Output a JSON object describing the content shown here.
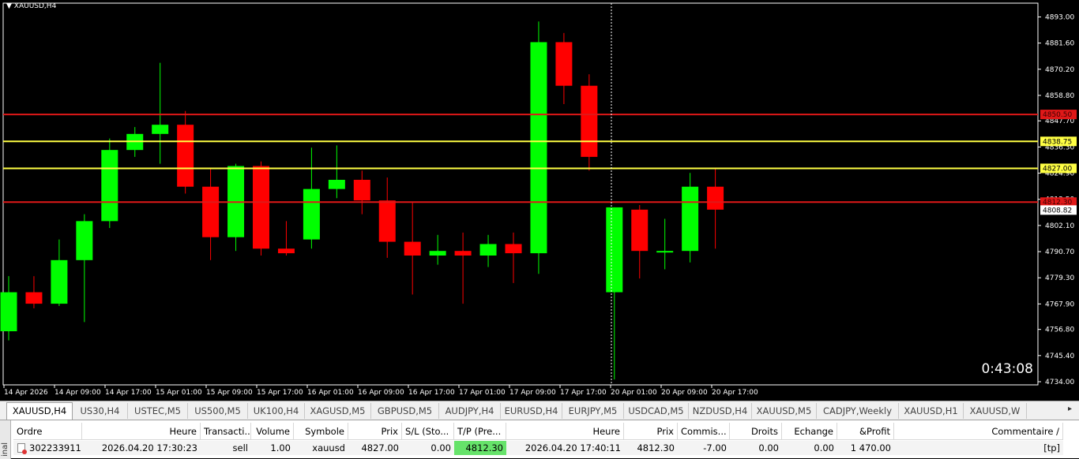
{
  "window": {
    "title": "XAUUSD,H4"
  },
  "countdown": "0:43:08",
  "colors": {
    "bull": "#00ff00",
    "bear": "#ff0000",
    "resistance_line": "#e01818",
    "yellow_line": "#ffff44",
    "axis": "#ffffff"
  },
  "chart_data": {
    "type": "candlestick",
    "symbol": "XAUUSD",
    "timeframe": "H4",
    "ylim": [
      4734,
      4899
    ],
    "y_ticks": [
      "4893.00",
      "4881.60",
      "4870.20",
      "4858.80",
      "4847.70",
      "4836.30",
      "4824.90",
      "4813.50",
      "4802.10",
      "4790.70",
      "4779.30",
      "4767.90",
      "4756.80",
      "4745.40",
      "4734.00"
    ],
    "x_ticks": [
      "14 Apr 2026",
      "14 Apr 09:00",
      "14 Apr 17:00",
      "15 Apr 01:00",
      "15 Apr 09:00",
      "15 Apr 17:00",
      "16 Apr 01:00",
      "16 Apr 09:00",
      "16 Apr 17:00",
      "17 Apr 01:00",
      "17 Apr 09:00",
      "17 Apr 17:00",
      "20 Apr 01:00",
      "20 Apr 09:00",
      "20 Apr 17:00"
    ],
    "candles": [
      {
        "o": 4756,
        "h": 4780,
        "l": 4752,
        "c": 4773
      },
      {
        "o": 4773,
        "h": 4780,
        "l": 4766,
        "c": 4768
      },
      {
        "o": 4768,
        "h": 4796,
        "l": 4767,
        "c": 4787
      },
      {
        "o": 4787,
        "h": 4807,
        "l": 4760,
        "c": 4804
      },
      {
        "o": 4804,
        "h": 4840,
        "l": 4801,
        "c": 4835
      },
      {
        "o": 4835,
        "h": 4845,
        "l": 4832,
        "c": 4842
      },
      {
        "o": 4842,
        "h": 4873,
        "l": 4829,
        "c": 4846
      },
      {
        "o": 4846,
        "h": 4852,
        "l": 4816,
        "c": 4819
      },
      {
        "o": 4819,
        "h": 4827,
        "l": 4787,
        "c": 4797
      },
      {
        "o": 4797,
        "h": 4829,
        "l": 4791,
        "c": 4828
      },
      {
        "o": 4828,
        "h": 4830,
        "l": 4789,
        "c": 4792
      },
      {
        "o": 4792,
        "h": 4804,
        "l": 4789,
        "c": 4790
      },
      {
        "o": 4796,
        "h": 4836,
        "l": 4792,
        "c": 4818
      },
      {
        "o": 4818,
        "h": 4837,
        "l": 4814,
        "c": 4822
      },
      {
        "o": 4822,
        "h": 4826,
        "l": 4807,
        "c": 4813
      },
      {
        "o": 4813,
        "h": 4823,
        "l": 4788,
        "c": 4795
      },
      {
        "o": 4795,
        "h": 4812,
        "l": 4772,
        "c": 4789
      },
      {
        "o": 4789,
        "h": 4798,
        "l": 4785,
        "c": 4791
      },
      {
        "o": 4791,
        "h": 4799,
        "l": 4768,
        "c": 4789
      },
      {
        "o": 4789,
        "h": 4798,
        "l": 4784,
        "c": 4794
      },
      {
        "o": 4794,
        "h": 4799,
        "l": 4777,
        "c": 4790
      },
      {
        "o": 4790,
        "h": 4891,
        "l": 4781,
        "c": 4882
      },
      {
        "o": 4882,
        "h": 4886,
        "l": 4855,
        "c": 4863
      },
      {
        "o": 4863,
        "h": 4868,
        "l": 4826,
        "c": 4832
      },
      {
        "o": 4773,
        "h": 4810,
        "l": 4735,
        "c": 4810
      },
      {
        "o": 4809,
        "h": 4811,
        "l": 4779,
        "c": 4791
      },
      {
        "o": 4791,
        "h": 4805,
        "l": 4783,
        "c": 4791
      },
      {
        "o": 4791,
        "h": 4825,
        "l": 4786,
        "c": 4819
      },
      {
        "o": 4819,
        "h": 4827,
        "l": 4792,
        "c": 4809
      }
    ],
    "hlines": [
      {
        "price": 4850.5,
        "label": "4850.50",
        "color": "#e01818",
        "label_bg": "#e01818",
        "label_fg": "#3a0000"
      },
      {
        "price": 4838.75,
        "label": "4838.75",
        "color": "#ffff44",
        "label_bg": "#ffff44",
        "label_fg": "#000000"
      },
      {
        "price": 4827.0,
        "label": "4827.00",
        "color": "#ffff44",
        "label_bg": "#ffff44",
        "label_fg": "#000000"
      },
      {
        "price": 4812.3,
        "label": "4812.30",
        "color": "#e01818",
        "label_bg": "#e01818",
        "label_fg": "#3a0000"
      }
    ],
    "current_price": {
      "price": 4808.82,
      "label": "4808.82"
    },
    "crosshair_x_tick": "20 Apr 01:00"
  },
  "tabs": [
    {
      "label": "XAUUSD,H4",
      "active": true
    },
    {
      "label": "US30,H4"
    },
    {
      "label": "USTEC,M5"
    },
    {
      "label": "US500,M5"
    },
    {
      "label": "UK100,H4"
    },
    {
      "label": "XAGUSD,M5"
    },
    {
      "label": "GBPUSD,M5"
    },
    {
      "label": "AUDJPY,H4"
    },
    {
      "label": "EURUSD,H4"
    },
    {
      "label": "EURJPY,M5"
    },
    {
      "label": "USDCAD,M5"
    },
    {
      "label": "NZDUSD,H4"
    },
    {
      "label": "XAUUSD,M5"
    },
    {
      "label": "CADJPY,Weekly"
    },
    {
      "label": "XAUUSD,H1"
    },
    {
      "label": "XAUUSD,W"
    }
  ],
  "terminal": {
    "side_label": "inal",
    "headers": [
      "Ordre",
      "Heure",
      "Transacti...",
      "Volume",
      "Symbole",
      "Prix",
      "S/L (Sto...",
      "T/P (Pre...",
      "Heure",
      "Prix",
      "Commis...",
      "Droits",
      "Echange",
      "&Profit",
      "Commentaire"
    ],
    "sort_indicator": "/",
    "row": [
      "302233911",
      "2026.04.20 17:30:23",
      "sell",
      "1.00",
      "xauusd",
      "4827.00",
      "0.00",
      "4812.30",
      "2026.04.20 17:40:11",
      "4812.30",
      "-7.00",
      "0.00",
      "0.00",
      "1 470.00",
      "[tp]"
    ]
  }
}
